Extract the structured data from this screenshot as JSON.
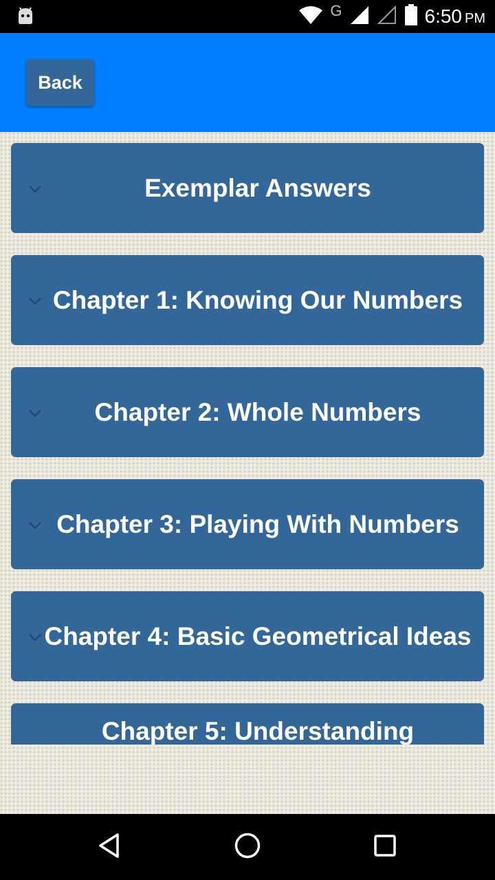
{
  "status_bar": {
    "time": "6:50",
    "ampm": "PM",
    "network_letter": "G",
    "icons": [
      "android-debug-icon",
      "wifi-icon",
      "signal-icon",
      "signal-empty-icon",
      "battery-icon"
    ]
  },
  "app_bar": {
    "back_label": "Back",
    "background_color": "#0080ff"
  },
  "chapters": [
    {
      "label": "Exemplar Answers"
    },
    {
      "label": "Chapter 1: Knowing Our Numbers"
    },
    {
      "label": "Chapter 2: Whole Numbers"
    },
    {
      "label": "Chapter 3: Playing With Numbers"
    },
    {
      "label": "Chapter 4: Basic Geometrical Ideas"
    },
    {
      "label": "Chapter 5: Understanding"
    }
  ],
  "colors": {
    "item_background": "#336699",
    "item_text": "#ffffff",
    "page_background": "#ece7dd"
  },
  "nav_bar": {
    "icons": [
      "back-triangle-icon",
      "home-circle-icon",
      "recents-square-icon"
    ]
  }
}
